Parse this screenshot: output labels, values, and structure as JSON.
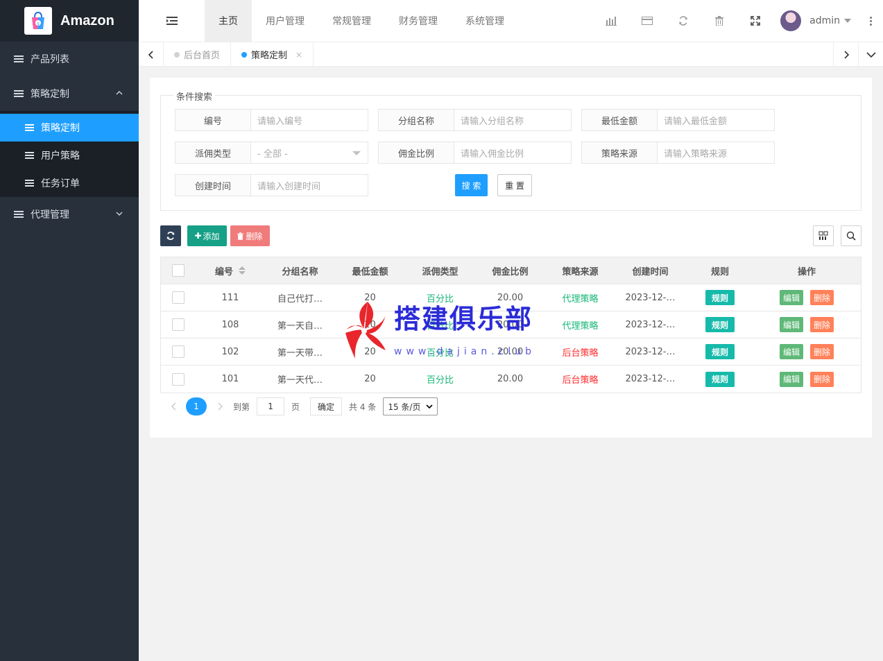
{
  "app": {
    "name": "Amazon"
  },
  "sidebar": {
    "items": [
      {
        "label": "产品列表"
      },
      {
        "label": "策略定制"
      },
      {
        "label": "代理管理"
      }
    ],
    "sub_items": [
      {
        "label": "策略定制"
      },
      {
        "label": "用户策略"
      },
      {
        "label": "任务订单"
      }
    ]
  },
  "header": {
    "menus": [
      {
        "label": "主页"
      },
      {
        "label": "用户管理"
      },
      {
        "label": "常规管理"
      },
      {
        "label": "财务管理"
      },
      {
        "label": "系统管理"
      }
    ],
    "username": "admin"
  },
  "tabs": [
    {
      "label": "后台首页"
    },
    {
      "label": "策略定制",
      "close": "×"
    }
  ],
  "search": {
    "legend": "条件搜索",
    "fields": [
      {
        "label": "编号",
        "placeholder": "请输入编号"
      },
      {
        "label": "分组名称",
        "placeholder": "请输入分组名称"
      },
      {
        "label": "最低金额",
        "placeholder": "请输入最低金额"
      },
      {
        "label": "派佣类型",
        "value": "- 全部 -"
      },
      {
        "label": "佣金比例",
        "placeholder": "请输入佣金比例"
      },
      {
        "label": "策略来源",
        "placeholder": "请输入策略来源"
      },
      {
        "label": "创建时间",
        "placeholder": "请输入创建时间"
      }
    ],
    "search_label": "搜 索",
    "reset_label": "重 置"
  },
  "toolbar": {
    "add_label": "添加",
    "delete_label": "删除"
  },
  "table": {
    "headers": [
      "编号",
      "分组名称",
      "最低金额",
      "派佣类型",
      "佣金比例",
      "策略来源",
      "创建时间",
      "规则",
      "操作"
    ],
    "rows": [
      {
        "id": "111",
        "group": "自己代打…",
        "min": "20",
        "type": "百分比",
        "ratio": "20.00",
        "source": "代理策略",
        "created": "2023-12-…"
      },
      {
        "id": "108",
        "group": "第一天自…",
        "min": "20",
        "type": "百分比",
        "ratio": "20.00",
        "source": "代理策略",
        "created": "2023-12-…"
      },
      {
        "id": "102",
        "group": "第一天带…",
        "min": "20",
        "type": "百分比",
        "ratio": "20.00",
        "source": "后台策略",
        "created": "2023-12-…"
      },
      {
        "id": "101",
        "group": "第一天代…",
        "min": "20",
        "type": "百分比",
        "ratio": "20.00",
        "source": "后台策略",
        "created": "2023-12-…"
      }
    ],
    "rule_label": "规则",
    "edit_label": "编辑",
    "delete_label": "删除"
  },
  "pager": {
    "current": "1",
    "goto_label": "到第",
    "goto_value": "1",
    "page_label": "页",
    "ok_label": "确定",
    "total": "共 4 条",
    "per_page": "15 条/页"
  },
  "watermark": {
    "title": "搭建俱乐部",
    "url": "www.dajian.club"
  },
  "colors": {
    "primary": "#1e9fff",
    "sidebar": "#28303c",
    "green": "#16b777",
    "red": "#ff2d2d",
    "teal": "#16baaa"
  }
}
